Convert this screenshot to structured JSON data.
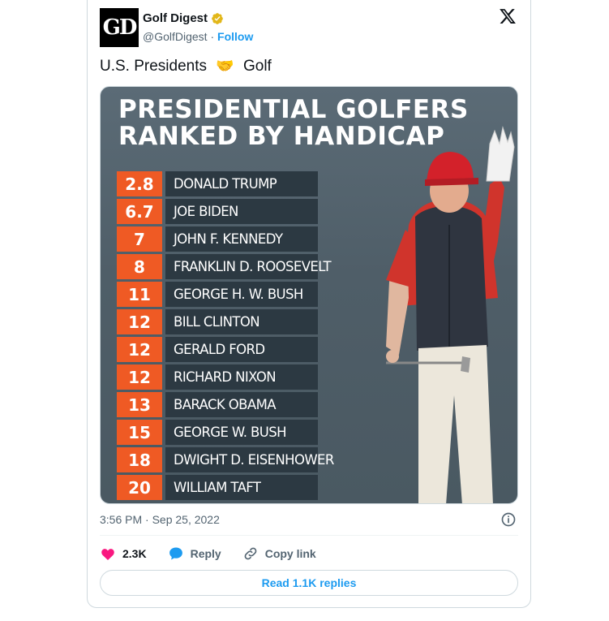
{
  "author": {
    "name": "Golf Digest",
    "handle": "@GolfDigest",
    "separator": "·",
    "follow_label": "Follow",
    "avatar_text": "GD"
  },
  "tweet": {
    "text_before": "U.S. Presidents",
    "emoji": "🤝",
    "text_after": "Golf"
  },
  "image": {
    "title_line1": "PRESIDENTIAL GOLFERS",
    "title_line2": "RANKED BY HANDICAP",
    "rankings": [
      {
        "handicap": "2.8",
        "name": "DONALD TRUMP"
      },
      {
        "handicap": "6.7",
        "name": "JOE BIDEN"
      },
      {
        "handicap": "7",
        "name": "JOHN F. KENNEDY"
      },
      {
        "handicap": "8",
        "name": "FRANKLIN D. ROOSEVELT"
      },
      {
        "handicap": "11",
        "name": "GEORGE H. W. BUSH"
      },
      {
        "handicap": "12",
        "name": "BILL CLINTON"
      },
      {
        "handicap": "12",
        "name": "GERALD FORD"
      },
      {
        "handicap": "12",
        "name": "RICHARD NIXON"
      },
      {
        "handicap": "13",
        "name": "BARACK OBAMA"
      },
      {
        "handicap": "15",
        "name": "GEORGE W. BUSH"
      },
      {
        "handicap": "18",
        "name": "DWIGHT D. EISENHOWER"
      },
      {
        "handicap": "20",
        "name": "WILLIAM TAFT"
      }
    ]
  },
  "meta": {
    "timestamp": "3:56 PM · Sep 25, 2022"
  },
  "actions": {
    "likes": "2.3K",
    "reply_label": "Reply",
    "copy_link_label": "Copy link"
  },
  "read_replies_label": "Read 1.1K replies",
  "colors": {
    "accent": "#1d9bf0",
    "like": "#f91880",
    "rank_orange": "#ef5a24",
    "rank_dark": "#2c3942"
  },
  "icons": {
    "verified": "verified-gold-badge-icon",
    "x_logo": "x-logo-icon",
    "info": "info-icon",
    "like": "heart-icon",
    "reply": "speech-bubble-icon",
    "copy_link": "link-icon"
  }
}
